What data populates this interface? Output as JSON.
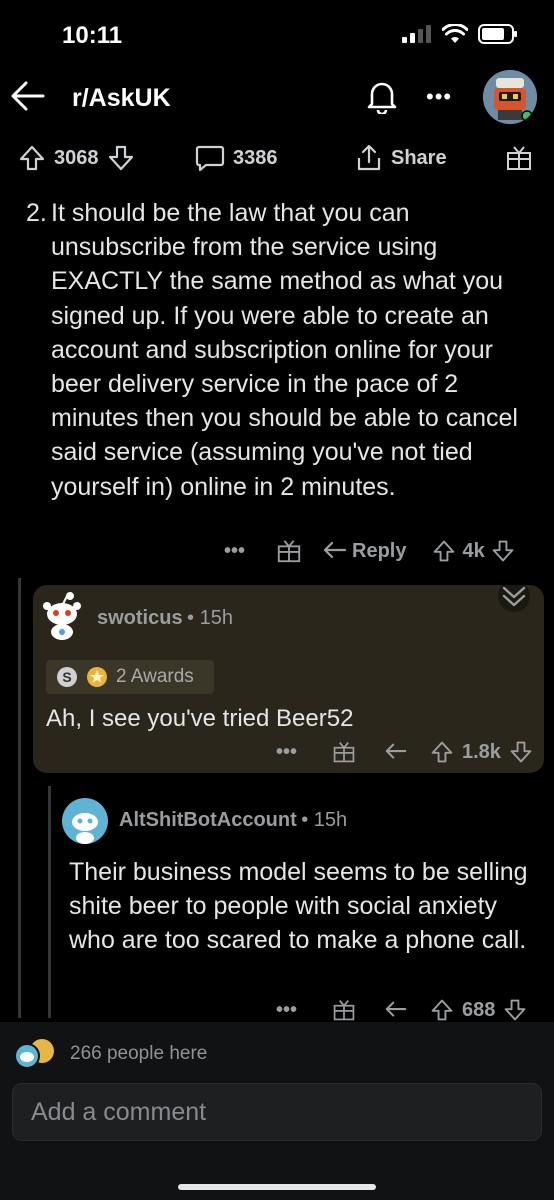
{
  "status": {
    "time": "10:11"
  },
  "header": {
    "subreddit": "r/AskUK"
  },
  "post_actions": {
    "upvotes": "3068",
    "comments": "3386",
    "share_label": "Share"
  },
  "parent_comment": {
    "number": "2.",
    "text": "It should be the law that you can unsubscribe from the service using EXACTLY the same method as what you signed up. If you were able to create an account and subscription online for your beer delivery service in the pace of 2 minutes then you should be able to cancel said service (assuming you've not tied yourself in) online in 2 minutes.",
    "reply_label": "Reply",
    "score": "4k"
  },
  "comment1": {
    "author": "swoticus",
    "age": "15h",
    "awards": "2 Awards",
    "text": "Ah, I see you've tried Beer52",
    "score": "1.8k"
  },
  "comment2": {
    "author": "AltShitBotAccount",
    "age": "15h",
    "text": "Their business model seems to be selling shite beer to people with social anxiety who are too scared to make a phone call.",
    "score": "688"
  },
  "footer": {
    "presence": "266 people here",
    "comment_placeholder": "Add a comment"
  }
}
